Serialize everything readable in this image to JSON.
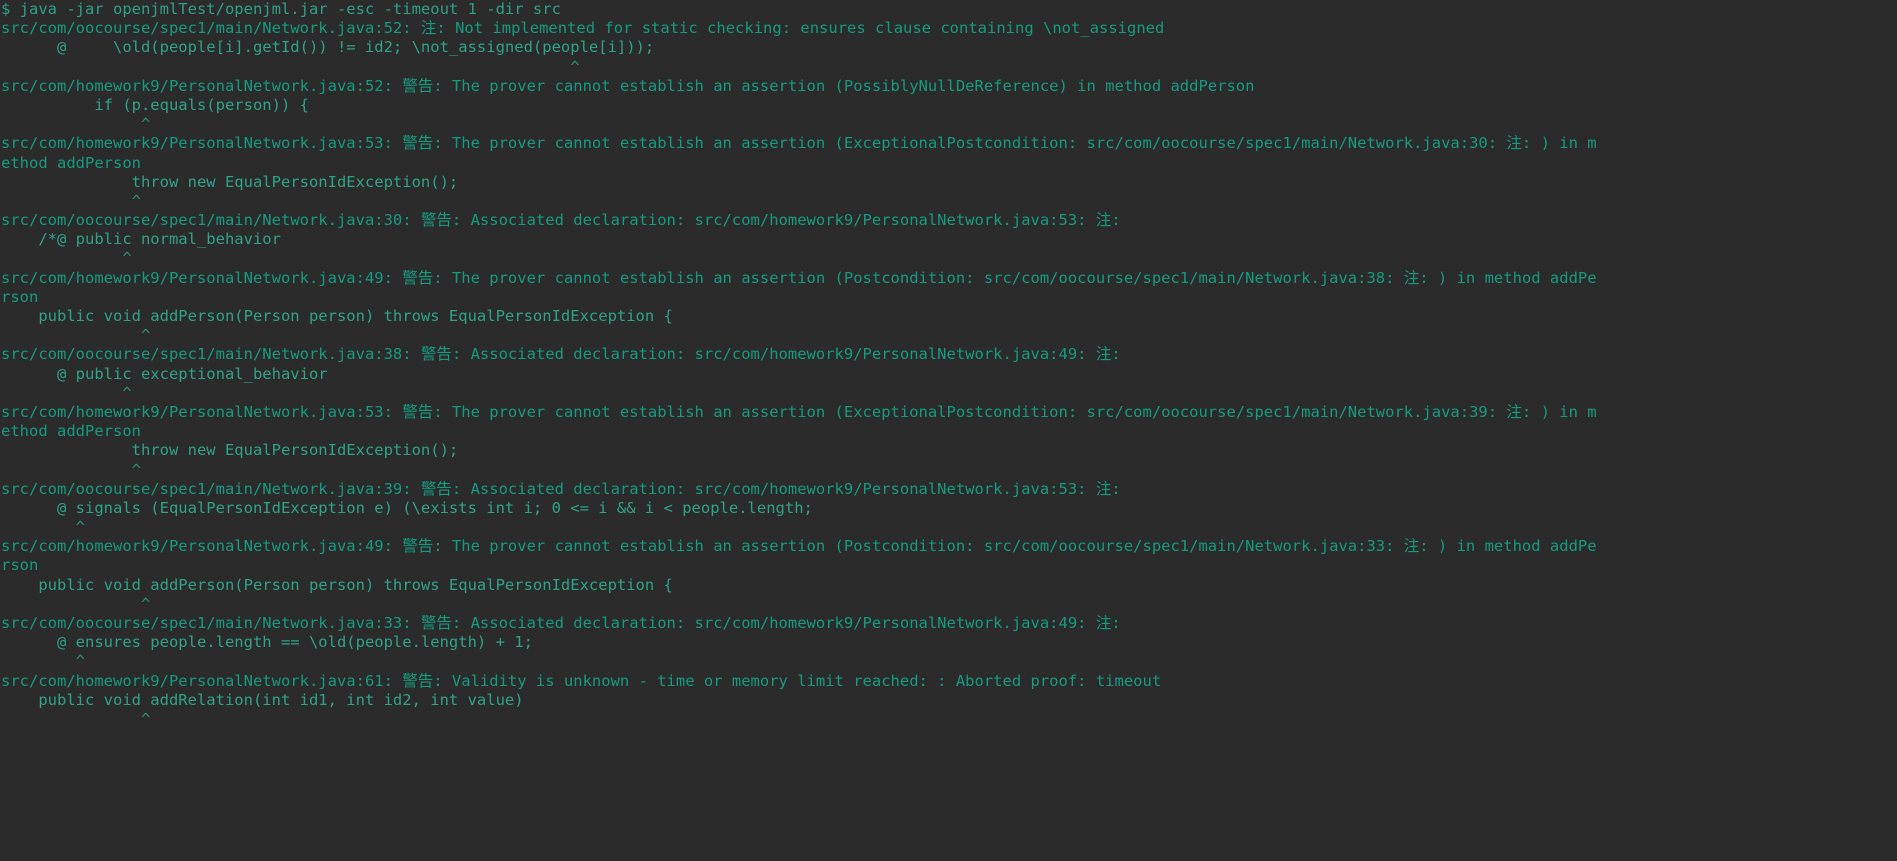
{
  "terminal": {
    "title": "Terminal",
    "background_color": "#2b2b2b",
    "foreground_color": "#2e9e7e",
    "prompt_symbol": "$",
    "command": "java -jar openjmlTest/openjml.jar -esc -timeout 1 -dir src",
    "columns": 159,
    "rows": 45,
    "lines": [
      {
        "id": "l01",
        "type": "prompt",
        "text": "$ java -jar openjmlTest/openjml.jar -esc -timeout 1 -dir src"
      },
      {
        "id": "l02",
        "type": "diagnostic",
        "text": "src/com/oocourse/spec1/main/Network.java:52: 注: Not implemented for static checking: ensures clause containing \\not_assigned"
      },
      {
        "id": "l03",
        "type": "source",
        "text": "      @     \\old(people[i].getId()) != id2; \\not_assigned(people[i]));"
      },
      {
        "id": "l04",
        "type": "caret",
        "text": "                                                             ^"
      },
      {
        "id": "l05",
        "type": "diagnostic",
        "text": "src/com/homework9/PersonalNetwork.java:52: 警告: The prover cannot establish an assertion (PossiblyNullDeReference) in method addPerson"
      },
      {
        "id": "l06",
        "type": "source",
        "text": "          if (p.equals(person)) {"
      },
      {
        "id": "l07",
        "type": "caret",
        "text": "               ^"
      },
      {
        "id": "l08",
        "type": "diagnostic",
        "text": "src/com/homework9/PersonalNetwork.java:53: 警告: The prover cannot establish an assertion (ExceptionalPostcondition: src/com/oocourse/spec1/main/Network.java:30: 注: ) in m"
      },
      {
        "id": "l09",
        "type": "diagnostic",
        "text": "ethod addPerson"
      },
      {
        "id": "l10",
        "type": "source",
        "text": "              throw new EqualPersonIdException();"
      },
      {
        "id": "l11",
        "type": "caret",
        "text": "              ^"
      },
      {
        "id": "l12",
        "type": "diagnostic",
        "text": "src/com/oocourse/spec1/main/Network.java:30: 警告: Associated declaration: src/com/homework9/PersonalNetwork.java:53: 注:"
      },
      {
        "id": "l13",
        "type": "source",
        "text": "    /*@ public normal_behavior"
      },
      {
        "id": "l14",
        "type": "caret",
        "text": "             ^"
      },
      {
        "id": "l15",
        "type": "diagnostic",
        "text": "src/com/homework9/PersonalNetwork.java:49: 警告: The prover cannot establish an assertion (Postcondition: src/com/oocourse/spec1/main/Network.java:38: 注: ) in method addPe"
      },
      {
        "id": "l16",
        "type": "diagnostic",
        "text": "rson"
      },
      {
        "id": "l17",
        "type": "source",
        "text": "    public void addPerson(Person person) throws EqualPersonIdException {"
      },
      {
        "id": "l18",
        "type": "caret",
        "text": "               ^"
      },
      {
        "id": "l19",
        "type": "diagnostic",
        "text": "src/com/oocourse/spec1/main/Network.java:38: 警告: Associated declaration: src/com/homework9/PersonalNetwork.java:49: 注:"
      },
      {
        "id": "l20",
        "type": "source",
        "text": "      @ public exceptional_behavior"
      },
      {
        "id": "l21",
        "type": "caret",
        "text": "             ^"
      },
      {
        "id": "l22",
        "type": "diagnostic",
        "text": "src/com/homework9/PersonalNetwork.java:53: 警告: The prover cannot establish an assertion (ExceptionalPostcondition: src/com/oocourse/spec1/main/Network.java:39: 注: ) in m"
      },
      {
        "id": "l23",
        "type": "diagnostic",
        "text": "ethod addPerson"
      },
      {
        "id": "l24",
        "type": "source",
        "text": "              throw new EqualPersonIdException();"
      },
      {
        "id": "l25",
        "type": "caret",
        "text": "              ^"
      },
      {
        "id": "l26",
        "type": "diagnostic",
        "text": "src/com/oocourse/spec1/main/Network.java:39: 警告: Associated declaration: src/com/homework9/PersonalNetwork.java:53: 注:"
      },
      {
        "id": "l27",
        "type": "source",
        "text": "      @ signals (EqualPersonIdException e) (\\exists int i; 0 <= i && i < people.length;"
      },
      {
        "id": "l28",
        "type": "caret",
        "text": "        ^"
      },
      {
        "id": "l29",
        "type": "diagnostic",
        "text": "src/com/homework9/PersonalNetwork.java:49: 警告: The prover cannot establish an assertion (Postcondition: src/com/oocourse/spec1/main/Network.java:33: 注: ) in method addPe"
      },
      {
        "id": "l30",
        "type": "diagnostic",
        "text": "rson"
      },
      {
        "id": "l31",
        "type": "source",
        "text": "    public void addPerson(Person person) throws EqualPersonIdException {"
      },
      {
        "id": "l32",
        "type": "caret",
        "text": "               ^"
      },
      {
        "id": "l33",
        "type": "diagnostic",
        "text": "src/com/oocourse/spec1/main/Network.java:33: 警告: Associated declaration: src/com/homework9/PersonalNetwork.java:49: 注:"
      },
      {
        "id": "l34",
        "type": "source",
        "text": "      @ ensures people.length == \\old(people.length) + 1;"
      },
      {
        "id": "l35",
        "type": "caret",
        "text": "        ^"
      },
      {
        "id": "l36",
        "type": "diagnostic",
        "text": "src/com/homework9/PersonalNetwork.java:61: 警告: Validity is unknown - time or memory limit reached: : Aborted proof: timeout"
      },
      {
        "id": "l37",
        "type": "source",
        "text": "    public void addRelation(int id1, int id2, int value)"
      },
      {
        "id": "l38",
        "type": "caret",
        "text": "               ^"
      }
    ]
  }
}
